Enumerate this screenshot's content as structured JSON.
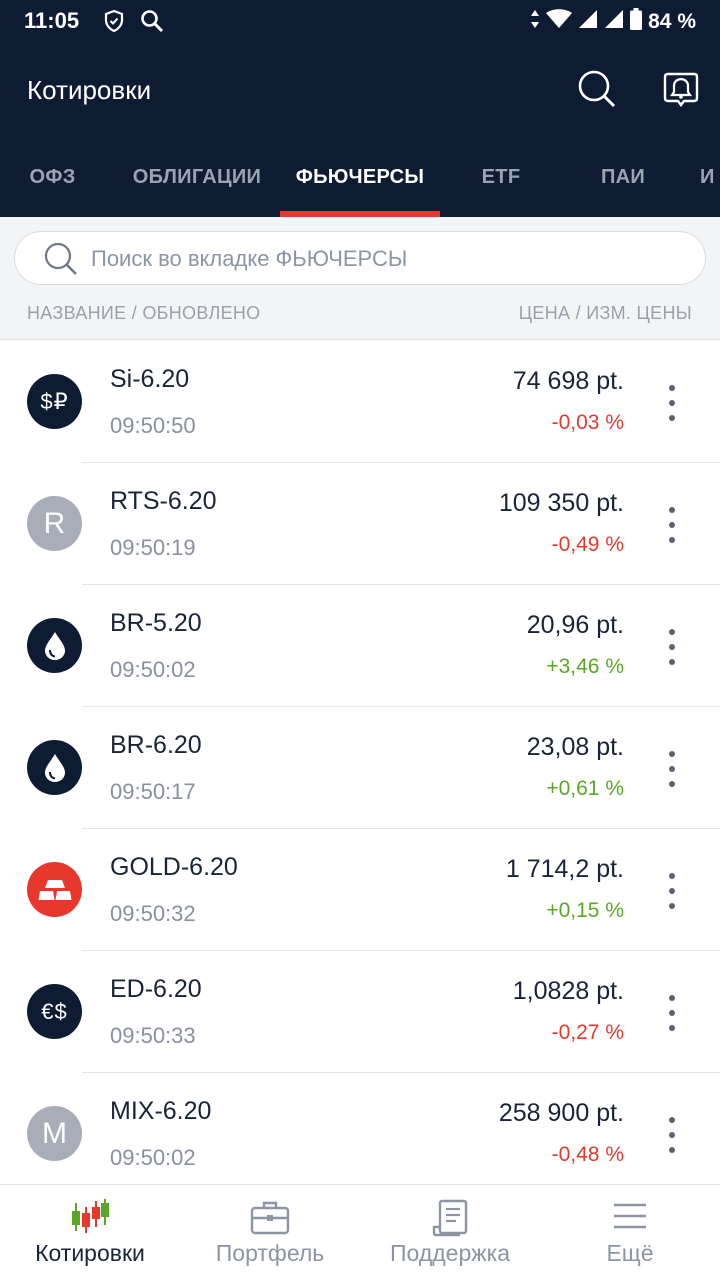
{
  "status_bar": {
    "time": "11:05",
    "battery": "84 %",
    "icons": [
      "shield-icon",
      "search-icon",
      "data-arrows-icon",
      "wifi-icon",
      "signal-icon",
      "signal-icon",
      "battery-icon"
    ]
  },
  "header": {
    "title": "Котировки",
    "icons": [
      "search-icon",
      "bell-icon"
    ]
  },
  "tabs": [
    {
      "label": "ОФЗ",
      "active": false
    },
    {
      "label": "ОБЛИГАЦИИ",
      "active": false
    },
    {
      "label": "ФЬЮЧЕРСЫ",
      "active": true
    },
    {
      "label": "ETF",
      "active": false
    },
    {
      "label": "ПАИ",
      "active": false
    },
    {
      "label": "И",
      "active": false
    }
  ],
  "search": {
    "placeholder": "Поиск во вкладке ФЬЮЧЕРСЫ",
    "value": ""
  },
  "columns": {
    "left": "НАЗВАНИЕ / ОБНОВЛЕНО",
    "right": "ЦЕНА / ИЗМ. ЦЕНЫ"
  },
  "items": [
    {
      "name": "Si-6.20",
      "time": "09:50:50",
      "price": "74 698 pt.",
      "change": "-0,03 %",
      "direction": "down",
      "avatar_text": "$₽",
      "icon": "dollar-ruble-icon"
    },
    {
      "name": "RTS-6.20",
      "time": "09:50:19",
      "price": "109 350 pt.",
      "change": "-0,49 %",
      "direction": "down",
      "avatar_text": "R",
      "icon": "letter-avatar"
    },
    {
      "name": "BR-5.20",
      "time": "09:50:02",
      "price": "20,96 pt.",
      "change": "+3,46 %",
      "direction": "up",
      "avatar_text": "",
      "icon": "oil-drop-icon"
    },
    {
      "name": "BR-6.20",
      "time": "09:50:17",
      "price": "23,08 pt.",
      "change": "+0,61 %",
      "direction": "up",
      "avatar_text": "",
      "icon": "oil-drop-icon"
    },
    {
      "name": "GOLD-6.20",
      "time": "09:50:32",
      "price": "1 714,2 pt.",
      "change": "+0,15 %",
      "direction": "up",
      "avatar_text": "",
      "icon": "gold-bars-icon"
    },
    {
      "name": "ED-6.20",
      "time": "09:50:33",
      "price": "1,0828 pt.",
      "change": "-0,27 %",
      "direction": "down",
      "avatar_text": "€$",
      "icon": "euro-dollar-icon"
    },
    {
      "name": "MIX-6.20",
      "time": "09:50:02",
      "price": "258 900 pt.",
      "change": "-0,48 %",
      "direction": "down",
      "avatar_text": "M",
      "icon": "letter-avatar"
    }
  ],
  "bottom_nav": [
    {
      "label": "Котировки",
      "icon": "candlestick-chart-icon",
      "active": true
    },
    {
      "label": "Портфель",
      "icon": "briefcase-icon",
      "active": false
    },
    {
      "label": "Поддержка",
      "icon": "document-icon",
      "active": false
    },
    {
      "label": "Ещё",
      "icon": "menu-icon",
      "active": false
    }
  ],
  "colors": {
    "header_bg": "#0e1c33",
    "accent_red": "#e8382e",
    "positive_green": "#5aa725",
    "negative_red": "#e8382e"
  }
}
